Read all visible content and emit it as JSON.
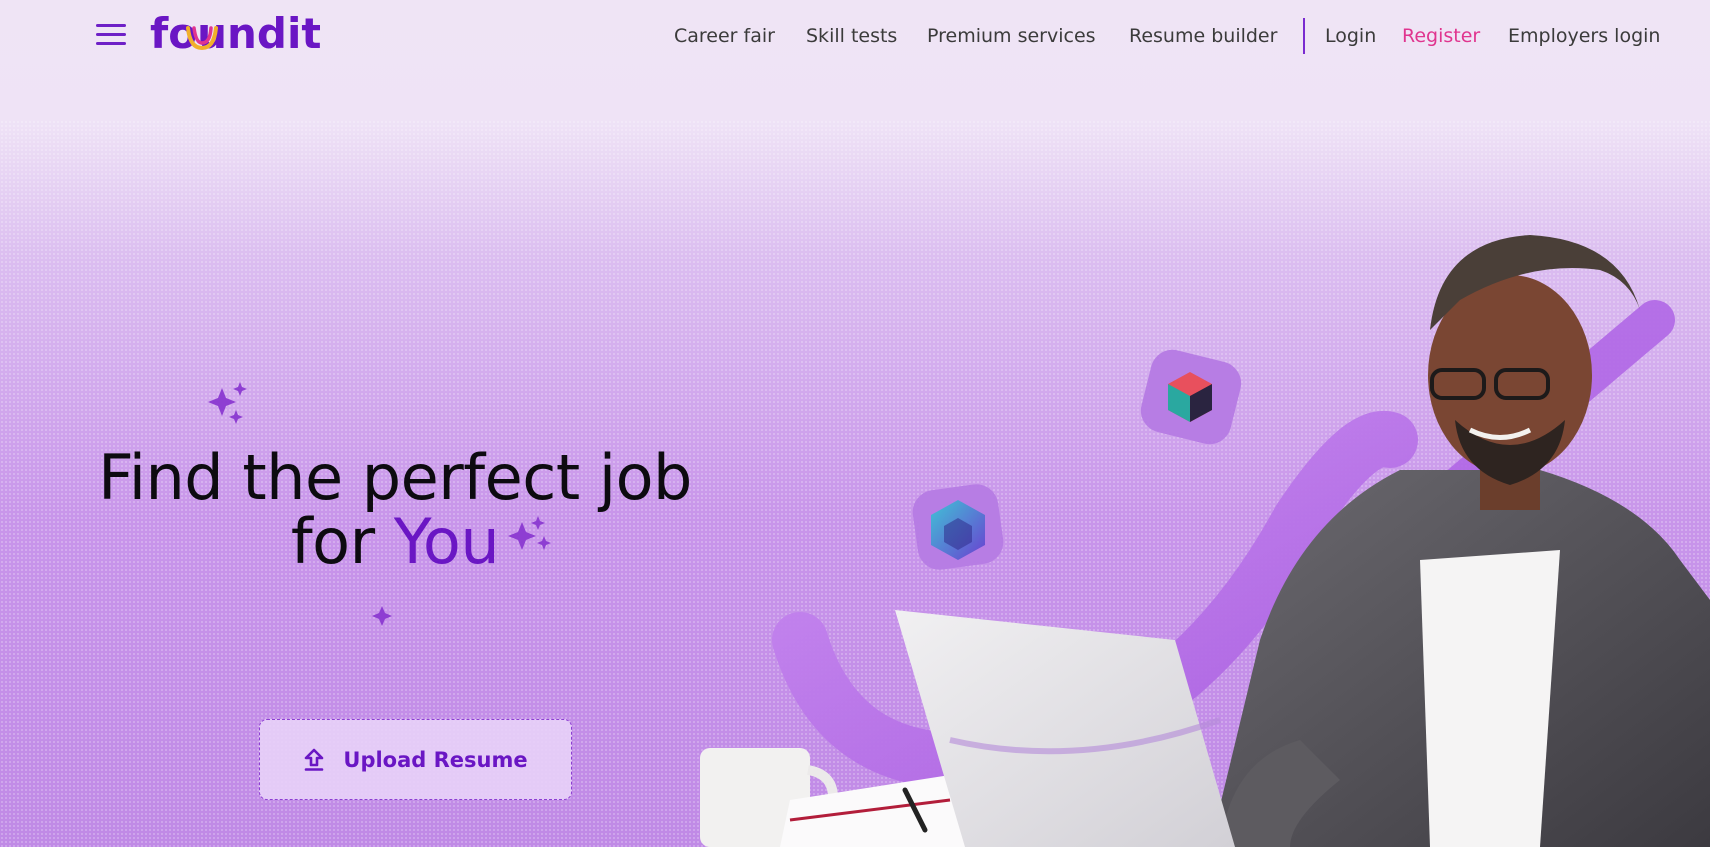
{
  "brand": {
    "logo_text": "foundit"
  },
  "nav": {
    "items": [
      {
        "label": "Career fair"
      },
      {
        "label": "Skill tests"
      },
      {
        "label": "Premium services"
      },
      {
        "label": "Resume builder"
      }
    ],
    "login": "Login",
    "register": "Register",
    "employers_login": "Employers login"
  },
  "hero": {
    "line1": "Find the perfect job",
    "line2_prefix": "for ",
    "line2_accent": "You",
    "upload_label": "Upload Resume"
  },
  "colors": {
    "brand_purple": "#6a16c4",
    "register_pink": "#e0358f",
    "nav_text": "#3b3b3b"
  },
  "icons": [
    "menu-icon",
    "upload-icon",
    "sparkle-icon"
  ]
}
